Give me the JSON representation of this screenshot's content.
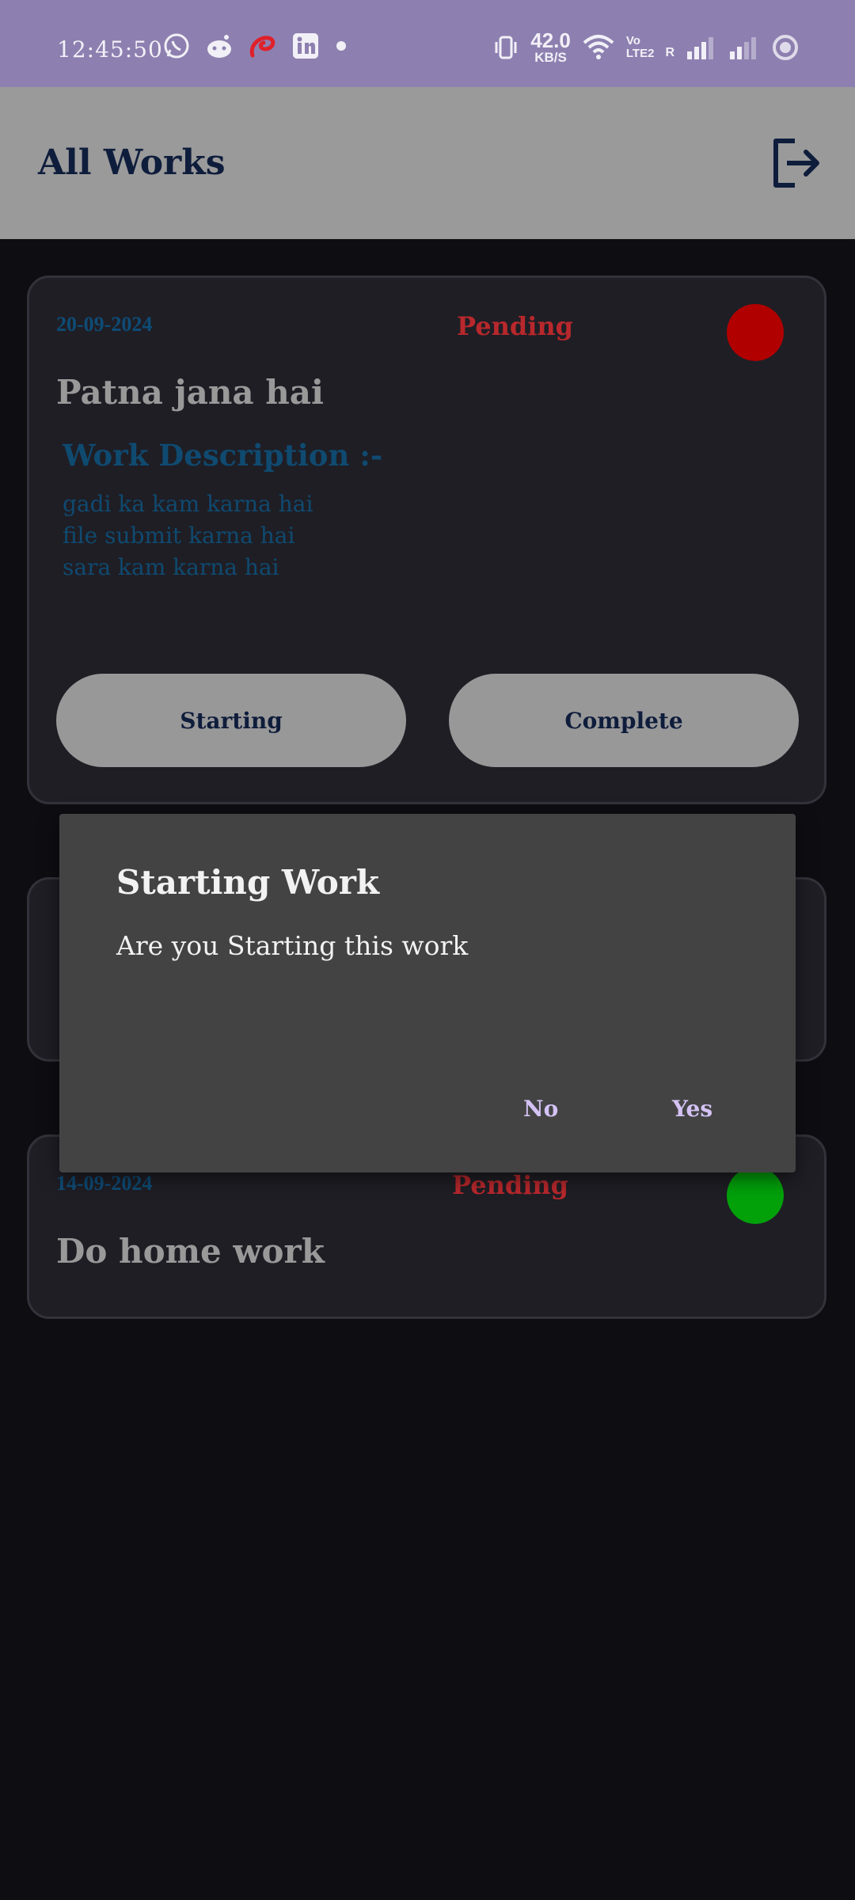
{
  "status_bar": {
    "time": "12:45:50",
    "net_speed_value": "42.0",
    "net_speed_unit": "KB/S",
    "volte_top": "Vo",
    "volte_bottom": "LTE2",
    "roaming": "R",
    "left_icons": [
      "whatsapp-icon",
      "reddit-icon",
      "airtel-icon",
      "linkedin-icon",
      "dot-icon"
    ],
    "right_icons": [
      "vibrate-icon",
      "wifi-icon",
      "signal-icon",
      "signal-icon",
      "hotspot-icon"
    ]
  },
  "appbar": {
    "title": "All Works",
    "logout_icon": "logout-icon"
  },
  "cards": [
    {
      "date": "20-09-2024",
      "status": "Pending",
      "dot_color": "#b10000",
      "title": "Patna jana hai",
      "description_heading": "Work Description :-",
      "description_lines": [
        "gadi ka kam karna hai",
        "file submit karna hai",
        "sara kam karna hai"
      ],
      "start_label": "Starting",
      "complete_label": "Complete"
    },
    {
      "date": "14-09-2024",
      "status": "Pending",
      "dot_color": "#02a10a",
      "title": "Do home work"
    }
  ],
  "dialog": {
    "title": "Starting Work",
    "message": "Are you Starting this work",
    "no_label": "No",
    "yes_label": "Yes"
  },
  "colors": {
    "status_bar": "#8d80b0",
    "appbar": "#9a9a9a",
    "background": "#0e0d12",
    "card": "#1f1e25",
    "pending": "#b8282c",
    "dialog": "#434343",
    "dialog_button": "#d4c2f5"
  }
}
